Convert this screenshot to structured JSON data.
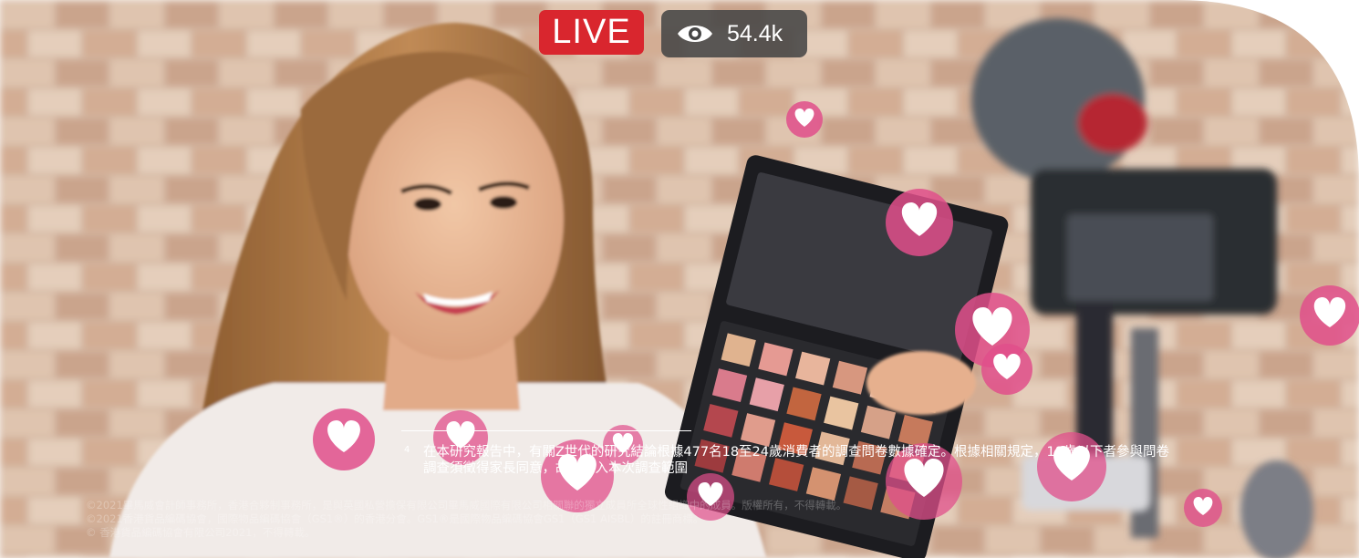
{
  "overlay": {
    "live_label": "LIVE",
    "viewer_count": "54.4k",
    "view_icon": "eye-icon",
    "heart_icon": "heart-reaction-icon"
  },
  "footnote": {
    "marker": "4",
    "line1": "在本研究報告中，有關Z世代的研究結論根據477名18至24歲消費者的調查問卷數據確定。根據相關規定，18歲以下者參與問卷",
    "line2": "調查須徵得家長同意，故未納入本次調查範圍"
  },
  "legal": {
    "line1": "©2021畢馬威會計師事務所，香港合夥制事務所，是與英國私營擔保有限公司畢馬威國際有限公司相關聯的獨立成員所全球性組織中的成員。版權所有，不得轉載。",
    "line2": "©2021香港貨品編碼協會，國際物品編碼協會（GS1®）的香港分會。GS1®是國際物品編碼協會GS1（GS1 AISBL）的註冊商標。",
    "line3": "© 香港貨品編碼協會有限公司2021，不得轉載。"
  },
  "colors": {
    "live_red": "#d9262e",
    "heart_pink": "#e04f8b",
    "badge_gray": "#464646"
  }
}
